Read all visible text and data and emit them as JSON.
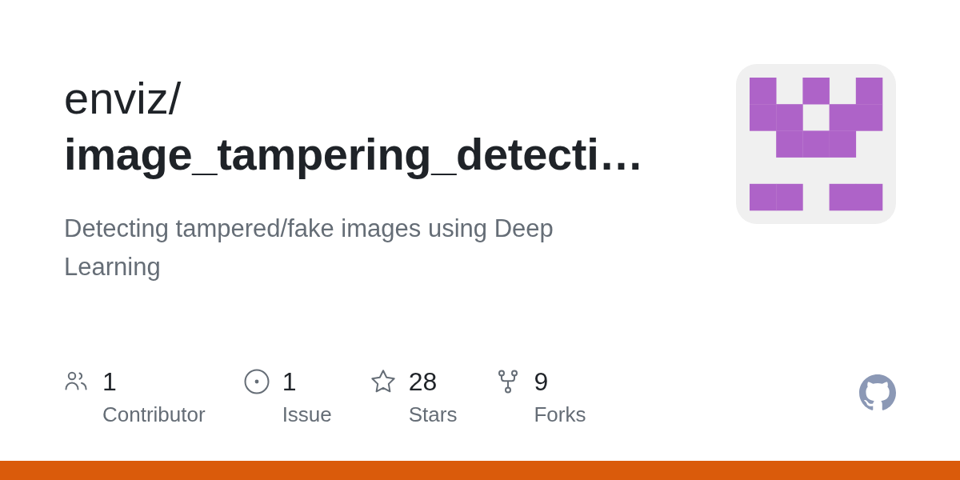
{
  "repository": {
    "owner": "enviz/",
    "name": "image_tampering_detecti…",
    "description": "Detecting tampered/fake images using Deep Learning"
  },
  "stats": [
    {
      "kind": "contributors",
      "count": "1",
      "label": "Contributor"
    },
    {
      "kind": "issues",
      "count": "1",
      "label": "Issue"
    },
    {
      "kind": "stars",
      "count": "28",
      "label": "Stars"
    },
    {
      "kind": "forks",
      "count": "9",
      "label": "Forks"
    }
  ],
  "language_bar": [
    {
      "color": "#da5b0b",
      "level": 1
    }
  ]
}
